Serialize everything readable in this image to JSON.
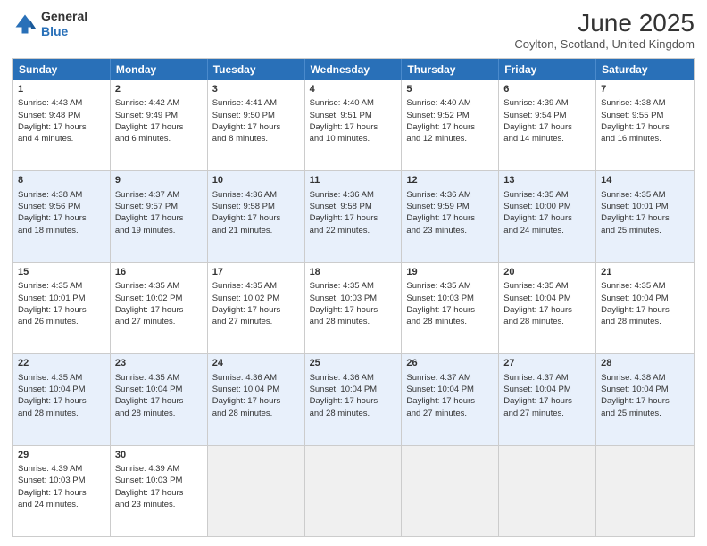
{
  "header": {
    "logo_line1": "General",
    "logo_line2": "Blue",
    "month_title": "June 2025",
    "subtitle": "Coylton, Scotland, United Kingdom"
  },
  "days_of_week": [
    "Sunday",
    "Monday",
    "Tuesday",
    "Wednesday",
    "Thursday",
    "Friday",
    "Saturday"
  ],
  "weeks": [
    [
      {
        "day": "1",
        "info": "Sunrise: 4:43 AM\nSunset: 9:48 PM\nDaylight: 17 hours\nand 4 minutes."
      },
      {
        "day": "2",
        "info": "Sunrise: 4:42 AM\nSunset: 9:49 PM\nDaylight: 17 hours\nand 6 minutes."
      },
      {
        "day": "3",
        "info": "Sunrise: 4:41 AM\nSunset: 9:50 PM\nDaylight: 17 hours\nand 8 minutes."
      },
      {
        "day": "4",
        "info": "Sunrise: 4:40 AM\nSunset: 9:51 PM\nDaylight: 17 hours\nand 10 minutes."
      },
      {
        "day": "5",
        "info": "Sunrise: 4:40 AM\nSunset: 9:52 PM\nDaylight: 17 hours\nand 12 minutes."
      },
      {
        "day": "6",
        "info": "Sunrise: 4:39 AM\nSunset: 9:54 PM\nDaylight: 17 hours\nand 14 minutes."
      },
      {
        "day": "7",
        "info": "Sunrise: 4:38 AM\nSunset: 9:55 PM\nDaylight: 17 hours\nand 16 minutes."
      }
    ],
    [
      {
        "day": "8",
        "info": "Sunrise: 4:38 AM\nSunset: 9:56 PM\nDaylight: 17 hours\nand 18 minutes."
      },
      {
        "day": "9",
        "info": "Sunrise: 4:37 AM\nSunset: 9:57 PM\nDaylight: 17 hours\nand 19 minutes."
      },
      {
        "day": "10",
        "info": "Sunrise: 4:36 AM\nSunset: 9:58 PM\nDaylight: 17 hours\nand 21 minutes."
      },
      {
        "day": "11",
        "info": "Sunrise: 4:36 AM\nSunset: 9:58 PM\nDaylight: 17 hours\nand 22 minutes."
      },
      {
        "day": "12",
        "info": "Sunrise: 4:36 AM\nSunset: 9:59 PM\nDaylight: 17 hours\nand 23 minutes."
      },
      {
        "day": "13",
        "info": "Sunrise: 4:35 AM\nSunset: 10:00 PM\nDaylight: 17 hours\nand 24 minutes."
      },
      {
        "day": "14",
        "info": "Sunrise: 4:35 AM\nSunset: 10:01 PM\nDaylight: 17 hours\nand 25 minutes."
      }
    ],
    [
      {
        "day": "15",
        "info": "Sunrise: 4:35 AM\nSunset: 10:01 PM\nDaylight: 17 hours\nand 26 minutes."
      },
      {
        "day": "16",
        "info": "Sunrise: 4:35 AM\nSunset: 10:02 PM\nDaylight: 17 hours\nand 27 minutes."
      },
      {
        "day": "17",
        "info": "Sunrise: 4:35 AM\nSunset: 10:02 PM\nDaylight: 17 hours\nand 27 minutes."
      },
      {
        "day": "18",
        "info": "Sunrise: 4:35 AM\nSunset: 10:03 PM\nDaylight: 17 hours\nand 28 minutes."
      },
      {
        "day": "19",
        "info": "Sunrise: 4:35 AM\nSunset: 10:03 PM\nDaylight: 17 hours\nand 28 minutes."
      },
      {
        "day": "20",
        "info": "Sunrise: 4:35 AM\nSunset: 10:04 PM\nDaylight: 17 hours\nand 28 minutes."
      },
      {
        "day": "21",
        "info": "Sunrise: 4:35 AM\nSunset: 10:04 PM\nDaylight: 17 hours\nand 28 minutes."
      }
    ],
    [
      {
        "day": "22",
        "info": "Sunrise: 4:35 AM\nSunset: 10:04 PM\nDaylight: 17 hours\nand 28 minutes."
      },
      {
        "day": "23",
        "info": "Sunrise: 4:35 AM\nSunset: 10:04 PM\nDaylight: 17 hours\nand 28 minutes."
      },
      {
        "day": "24",
        "info": "Sunrise: 4:36 AM\nSunset: 10:04 PM\nDaylight: 17 hours\nand 28 minutes."
      },
      {
        "day": "25",
        "info": "Sunrise: 4:36 AM\nSunset: 10:04 PM\nDaylight: 17 hours\nand 28 minutes."
      },
      {
        "day": "26",
        "info": "Sunrise: 4:37 AM\nSunset: 10:04 PM\nDaylight: 17 hours\nand 27 minutes."
      },
      {
        "day": "27",
        "info": "Sunrise: 4:37 AM\nSunset: 10:04 PM\nDaylight: 17 hours\nand 27 minutes."
      },
      {
        "day": "28",
        "info": "Sunrise: 4:38 AM\nSunset: 10:04 PM\nDaylight: 17 hours\nand 25 minutes."
      }
    ],
    [
      {
        "day": "29",
        "info": "Sunrise: 4:39 AM\nSunset: 10:03 PM\nDaylight: 17 hours\nand 24 minutes."
      },
      {
        "day": "30",
        "info": "Sunrise: 4:39 AM\nSunset: 10:03 PM\nDaylight: 17 hours\nand 23 minutes."
      },
      {
        "day": "",
        "info": ""
      },
      {
        "day": "",
        "info": ""
      },
      {
        "day": "",
        "info": ""
      },
      {
        "day": "",
        "info": ""
      },
      {
        "day": "",
        "info": ""
      }
    ]
  ]
}
